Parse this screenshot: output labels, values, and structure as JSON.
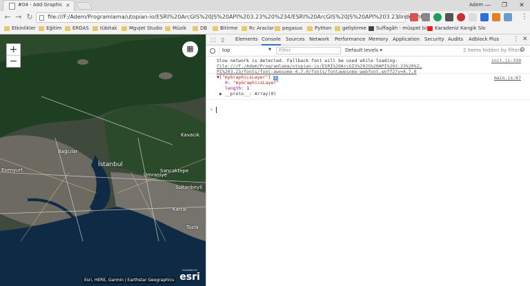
{
  "browser": {
    "tab_title": "#04 - Add Graphics | ESRI",
    "tab_close": "×",
    "profile_name": "Adem",
    "window_controls": {
      "minimize": "—",
      "restore": "❐",
      "close": "✕"
    },
    "url": "file:///F:/Adem/Programlama/utopian-io/ESRI%20ArcGIS%20JS%20API%203.23%20%234/ESRI%20ArcGIS%20JS%20API%203.23/index.html",
    "nav": {
      "back": "←",
      "forward": "→",
      "reload": "↻"
    },
    "star": "☆",
    "menu": "⋮"
  },
  "bookmarks": [
    {
      "label": "Etkinlikler",
      "kind": "folder"
    },
    {
      "label": "Eğitim",
      "kind": "folder"
    },
    {
      "label": "ERDAS",
      "kind": "folder"
    },
    {
      "label": "tübitak",
      "kind": "folder"
    },
    {
      "label": "MgvJet Studio",
      "kind": "folder"
    },
    {
      "label": "Müzik",
      "kind": "folder"
    },
    {
      "label": "DB",
      "kind": "folder"
    },
    {
      "label": "Bitirme",
      "kind": "folder"
    },
    {
      "label": "Rc Araclar",
      "kind": "folder"
    },
    {
      "label": "pegasus",
      "kind": "folder"
    },
    {
      "label": "Python",
      "kind": "folder"
    },
    {
      "label": "geliştirme",
      "kind": "folder"
    },
    {
      "label": "Suffagâh - müspet bi",
      "kind": "site"
    },
    {
      "label": "Karadeniz Kangik Slo",
      "kind": "youtube"
    }
  ],
  "map": {
    "zoom_in": "+",
    "zoom_out": "−",
    "basemap_icon": "▦",
    "labels": [
      {
        "text": "İstanbul",
        "big": true
      },
      {
        "text": "Sancaktepe",
        "big": false
      },
      {
        "text": "Ümraniye",
        "big": false
      },
      {
        "text": "Kartal",
        "big": false
      },
      {
        "text": "Kavacık",
        "big": false
      },
      {
        "text": "Tuzla",
        "big": false
      },
      {
        "text": "Esenyurt",
        "big": false
      },
      {
        "text": "Bağcılar",
        "big": false
      },
      {
        "text": "Sultanbeyli",
        "big": false
      }
    ],
    "attribution": "Esri, HERE, Garmin | Earthstar Geographics",
    "esri_powered_by": "POWERED BY",
    "esri_word": "esri"
  },
  "devtools": {
    "tabs": [
      "Elements",
      "Console",
      "Sources",
      "Network",
      "Performance",
      "Memory",
      "Application",
      "Security",
      "Audits",
      "Adblock Plus"
    ],
    "active_tab": "Console",
    "context": "top",
    "filter_placeholder": "Filter",
    "levels_label": "Default levels ▾",
    "hidden_note": "2 items hidden by filters",
    "menu": "⋮",
    "close": "✕",
    "gear": "⚙",
    "console": {
      "warning_text": "Slow network is detected. Fallback font will be used while loading: ",
      "warning_link": "file:///F:/Adem/Programlama/utopian-io/ESRI%20ArcGIS%20JS%20API%203.23%20%2…PI%203.23/fonts/font-awesome-4.7.0/fonts/fontawesome-webfont.woff2?v=4.7.0",
      "warning_source": "init.js:339",
      "log_source": "main.js:67",
      "array_preview": "▼[\"myGraphicsLayer\"]",
      "info_badge": "i",
      "index_key": "0:",
      "index_value": "\"myGraphicsLayer\"",
      "length_key": "length:",
      "length_value": "1",
      "proto_line": "▶ __proto__: Array(0)",
      "prompt": "›"
    }
  }
}
